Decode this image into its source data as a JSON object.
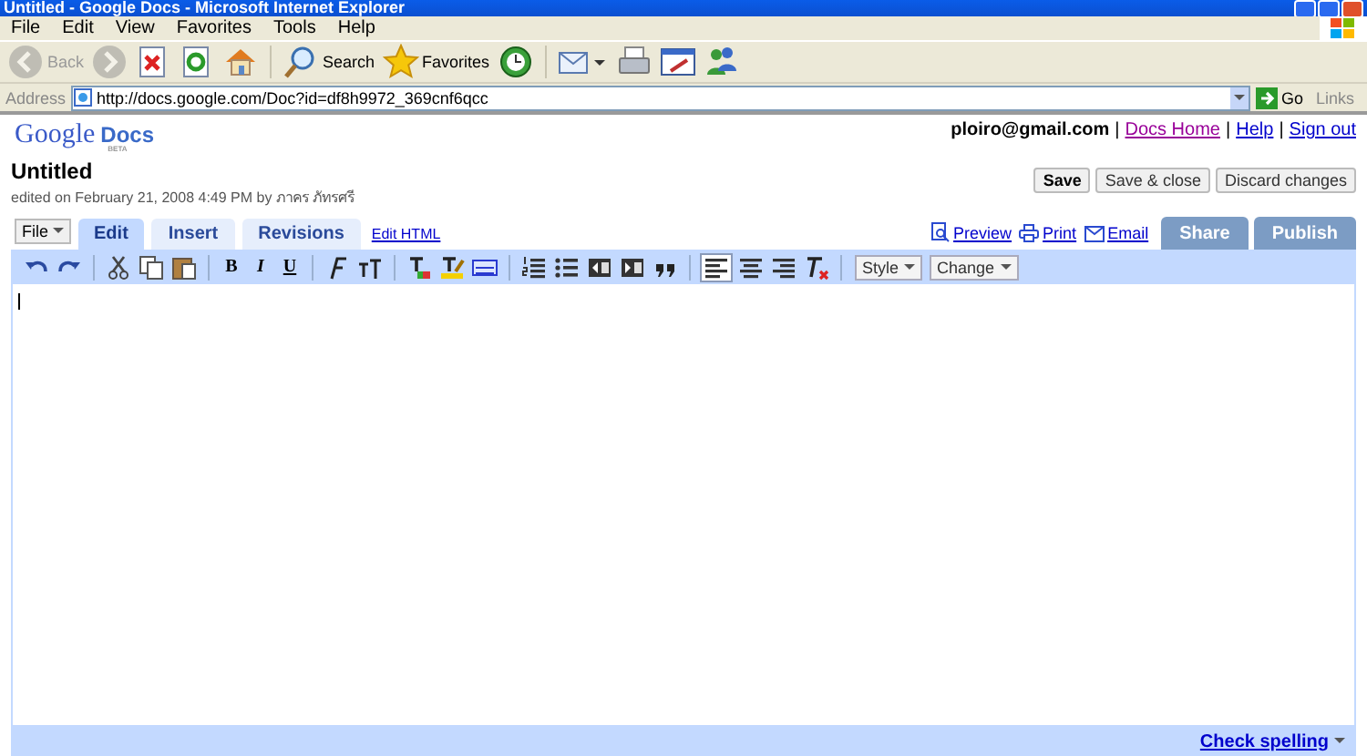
{
  "window": {
    "title": "Untitled - Google Docs - Microsoft Internet Explorer"
  },
  "menu": [
    "File",
    "Edit",
    "View",
    "Favorites",
    "Tools",
    "Help"
  ],
  "browser_toolbar": [
    {
      "kind": "back",
      "label": "Back",
      "disabled": true
    },
    {
      "kind": "forward",
      "disabled": true
    },
    {
      "kind": "stop",
      "disabled": false
    },
    {
      "kind": "refresh",
      "disabled": false
    },
    {
      "kind": "home",
      "disabled": false
    },
    {
      "kind": "search",
      "label": "Search",
      "disabled": false
    },
    {
      "kind": "favorites",
      "label": "Favorites",
      "disabled": false
    },
    {
      "kind": "history",
      "disabled": false
    },
    {
      "kind": "mail",
      "disabled": false
    },
    {
      "kind": "print",
      "disabled": false
    },
    {
      "kind": "edit",
      "disabled": false
    },
    {
      "kind": "messenger",
      "disabled": false
    }
  ],
  "address_bar": {
    "label": "Address",
    "url": "http://docs.google.com/Doc?id=df8h9972_369cnf6qcc",
    "go": "Go",
    "links": "Links"
  },
  "logo": {
    "text": "Google",
    "product": "Docs",
    "badge": "BETA"
  },
  "account": {
    "email": "ploiro@gmail.com",
    "separator": "|",
    "links": [
      "Docs Home",
      "Help",
      "Sign out"
    ]
  },
  "document": {
    "title": "Untitled",
    "edited": "edited on February 21, 2008 4:49 PM by ภาคร ภัทรศรี"
  },
  "actions": [
    "Save",
    "Save & close",
    "Discard changes"
  ],
  "file_menu": "File",
  "tabs": [
    {
      "label": "Edit",
      "selected": true
    },
    {
      "label": "Insert",
      "selected": false
    },
    {
      "label": "Revisions",
      "selected": false
    }
  ],
  "edit_html": "Edit HTML",
  "doc_links": [
    {
      "kind": "preview",
      "label": "Preview"
    },
    {
      "kind": "print",
      "label": "Print"
    },
    {
      "kind": "email",
      "label": "Email"
    }
  ],
  "share_buttons": [
    "Share",
    "Publish"
  ],
  "format_toolbar": [
    {
      "kind": "undo",
      "selected": false
    },
    {
      "kind": "redo",
      "selected": false
    },
    {
      "kind": "sep"
    },
    {
      "kind": "cut",
      "selected": false
    },
    {
      "kind": "copy",
      "selected": false
    },
    {
      "kind": "paste",
      "selected": false
    },
    {
      "kind": "sep"
    },
    {
      "kind": "bold",
      "label": "B",
      "selected": false
    },
    {
      "kind": "italic",
      "label": "I",
      "selected": false
    },
    {
      "kind": "underline",
      "label": "U",
      "selected": false
    },
    {
      "kind": "sep"
    },
    {
      "kind": "font",
      "selected": false
    },
    {
      "kind": "size",
      "selected": false
    },
    {
      "kind": "sep"
    },
    {
      "kind": "color",
      "selected": false
    },
    {
      "kind": "highlight",
      "selected": false
    },
    {
      "kind": "link",
      "selected": false
    },
    {
      "kind": "sep"
    },
    {
      "kind": "numbered",
      "selected": false
    },
    {
      "kind": "bullets",
      "selected": false
    },
    {
      "kind": "outdent",
      "selected": false
    },
    {
      "kind": "indent",
      "selected": false
    },
    {
      "kind": "quote",
      "selected": false
    },
    {
      "kind": "sep"
    },
    {
      "kind": "left",
      "selected": true
    },
    {
      "kind": "center",
      "selected": false
    },
    {
      "kind": "right",
      "selected": false
    },
    {
      "kind": "clear",
      "selected": false
    },
    {
      "kind": "sep"
    },
    {
      "kind": "dropdown",
      "label": "Style"
    },
    {
      "kind": "dropdown",
      "label": "Change"
    }
  ],
  "status_bar": {
    "check_spelling": "Check spelling"
  }
}
